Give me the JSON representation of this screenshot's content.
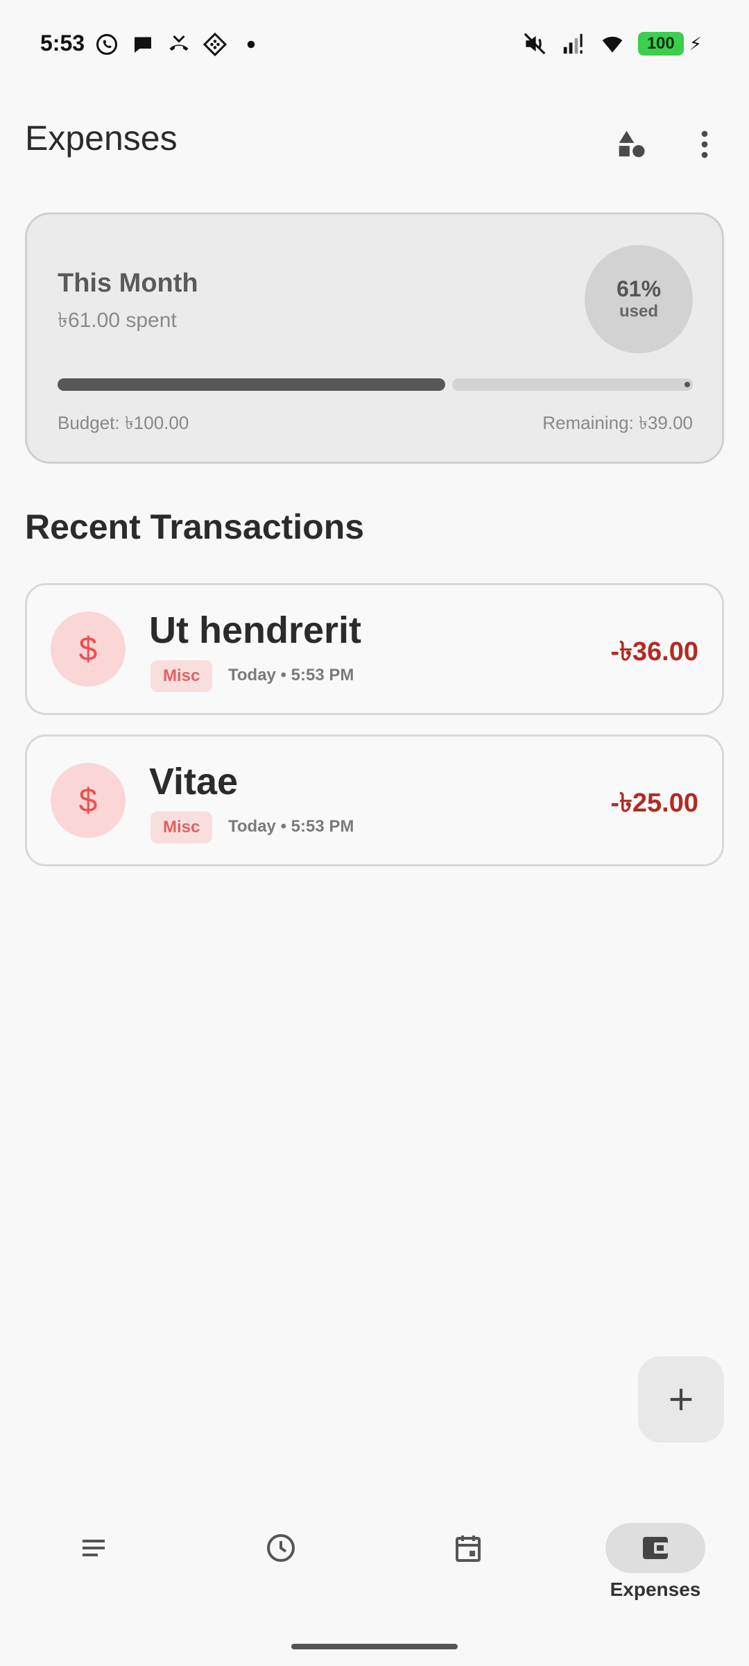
{
  "status_bar": {
    "time": "5:53",
    "battery": "100",
    "left_icons": [
      "whatsapp-icon",
      "chat-bubble-icon",
      "missed-call-icon",
      "dotted-diamond-icon",
      "dot-icon"
    ],
    "right_icons": [
      "mute-icon",
      "signal-icon",
      "wifi-icon",
      "battery-icon"
    ]
  },
  "app_bar": {
    "title": "Expenses",
    "actions": [
      "categories-icon",
      "more-vert-icon"
    ]
  },
  "budget_card": {
    "title": "This Month",
    "spent": "৳61.00 spent",
    "percent": "61%",
    "percent_caption": "used",
    "progress_fraction": 0.61,
    "budget": "Budget: ৳100.00",
    "remaining": "Remaining: ৳39.00"
  },
  "recent": {
    "title": "Recent Transactions",
    "items": [
      {
        "icon": "$",
        "name": "Ut hendrerit",
        "tag": "Misc",
        "time": "Today • 5:53 PM",
        "amount": "-৳36.00"
      },
      {
        "icon": "$",
        "name": "Vitae",
        "tag": "Misc",
        "time": "Today • 5:53 PM",
        "amount": "-৳25.00"
      }
    ]
  },
  "fab": {
    "icon": "add-icon"
  },
  "bottom_nav": {
    "items": [
      {
        "icon": "notes-icon",
        "label": ""
      },
      {
        "icon": "clock-icon",
        "label": ""
      },
      {
        "icon": "calendar-icon",
        "label": ""
      },
      {
        "icon": "wallet-icon",
        "label": "Expenses"
      }
    ],
    "active_index": 3
  },
  "colors": {
    "accent_red": "#b22a22",
    "tag_red": "#e0625f",
    "battery_green": "#3ccf4e"
  }
}
